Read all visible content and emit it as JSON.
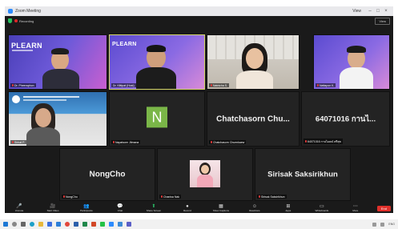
{
  "window": {
    "title": "Zoom Meeting",
    "view_label": "View",
    "buttons": [
      "–",
      "□",
      "×"
    ]
  },
  "meeting_topbar": {
    "recording_label": "Recording",
    "view_button": "View"
  },
  "tiles": [
    {
      "id": "t1",
      "name": "Dr. Pheeraphon",
      "banner": "PLEARN",
      "kind": "video-purple",
      "active": false,
      "muted": true
    },
    {
      "id": "t2",
      "name": "Dr. Kittipat (Host)",
      "banner": "PLEARN",
      "kind": "video-purple2",
      "active": true,
      "muted": false
    },
    {
      "id": "t3",
      "name": "Natnicha S.",
      "kind": "video-room",
      "active": false,
      "muted": true
    },
    {
      "id": "t4",
      "name": "Nattapon K.",
      "kind": "video-purple3",
      "active": false,
      "muted": true
    },
    {
      "id": "t5",
      "name": "Sirirat P.",
      "kind": "video-screen",
      "active": false,
      "muted": true
    },
    {
      "id": "t6",
      "name": "Napatsorn Jitmana",
      "avatar_letter": "N",
      "kind": "avatar",
      "active": false,
      "muted": true
    },
    {
      "id": "t7",
      "display_name": "Chatchasorn Chu...",
      "name": "Chatchasorn Chuenkaew",
      "kind": "name-only",
      "active": false,
      "muted": true
    },
    {
      "id": "t8",
      "display_name": "64071016 กานไ...",
      "name": "64071016 กานไอลณ์ ศรีสุข",
      "kind": "name-only",
      "active": false,
      "muted": true
    },
    {
      "id": "t9",
      "display_name": "NongCho",
      "name": "NongCho",
      "kind": "name-only",
      "active": false,
      "muted": true
    },
    {
      "id": "t10",
      "name": "Chanisa Nak",
      "kind": "video-pink",
      "active": false,
      "muted": true
    },
    {
      "id": "t11",
      "display_name": "Sirisak Saksirikhun",
      "name": "Sirisak Saksirikhun",
      "kind": "name-only",
      "active": false,
      "muted": true
    }
  ],
  "toolbar": [
    {
      "icon": "🎤",
      "label": "Unmute",
      "icon_name": "microphone-icon"
    },
    {
      "icon": "🎥",
      "label": "Start Video",
      "icon_name": "camera-icon"
    },
    {
      "icon": "👥",
      "label": "Participants",
      "icon_name": "participants-icon"
    },
    {
      "icon": "💬",
      "label": "Chat",
      "icon_name": "chat-icon"
    },
    {
      "icon": "⬆",
      "label": "Share Screen",
      "icon_name": "share-screen-icon",
      "green": true
    },
    {
      "icon": "●",
      "label": "Record",
      "icon_name": "record-icon"
    },
    {
      "icon": "▦",
      "label": "Show Captions",
      "icon_name": "captions-icon"
    },
    {
      "icon": "☺",
      "label": "Reactions",
      "icon_name": "reactions-icon"
    },
    {
      "icon": "⊞",
      "label": "Apps",
      "icon_name": "apps-icon"
    },
    {
      "icon": "▭",
      "label": "Whiteboards",
      "icon_name": "whiteboard-icon"
    },
    {
      "icon": "⋯",
      "label": "More",
      "icon_name": "more-icon"
    }
  ],
  "end_button": "End",
  "colors": {
    "meeting_bg": "#1a1a1a",
    "active_border": "#d6d66a",
    "end_red": "#e0302b",
    "share_green": "#2cc36b",
    "avatar_green": "#7ab648"
  },
  "taskbar": {
    "tray_text": "ENG"
  }
}
